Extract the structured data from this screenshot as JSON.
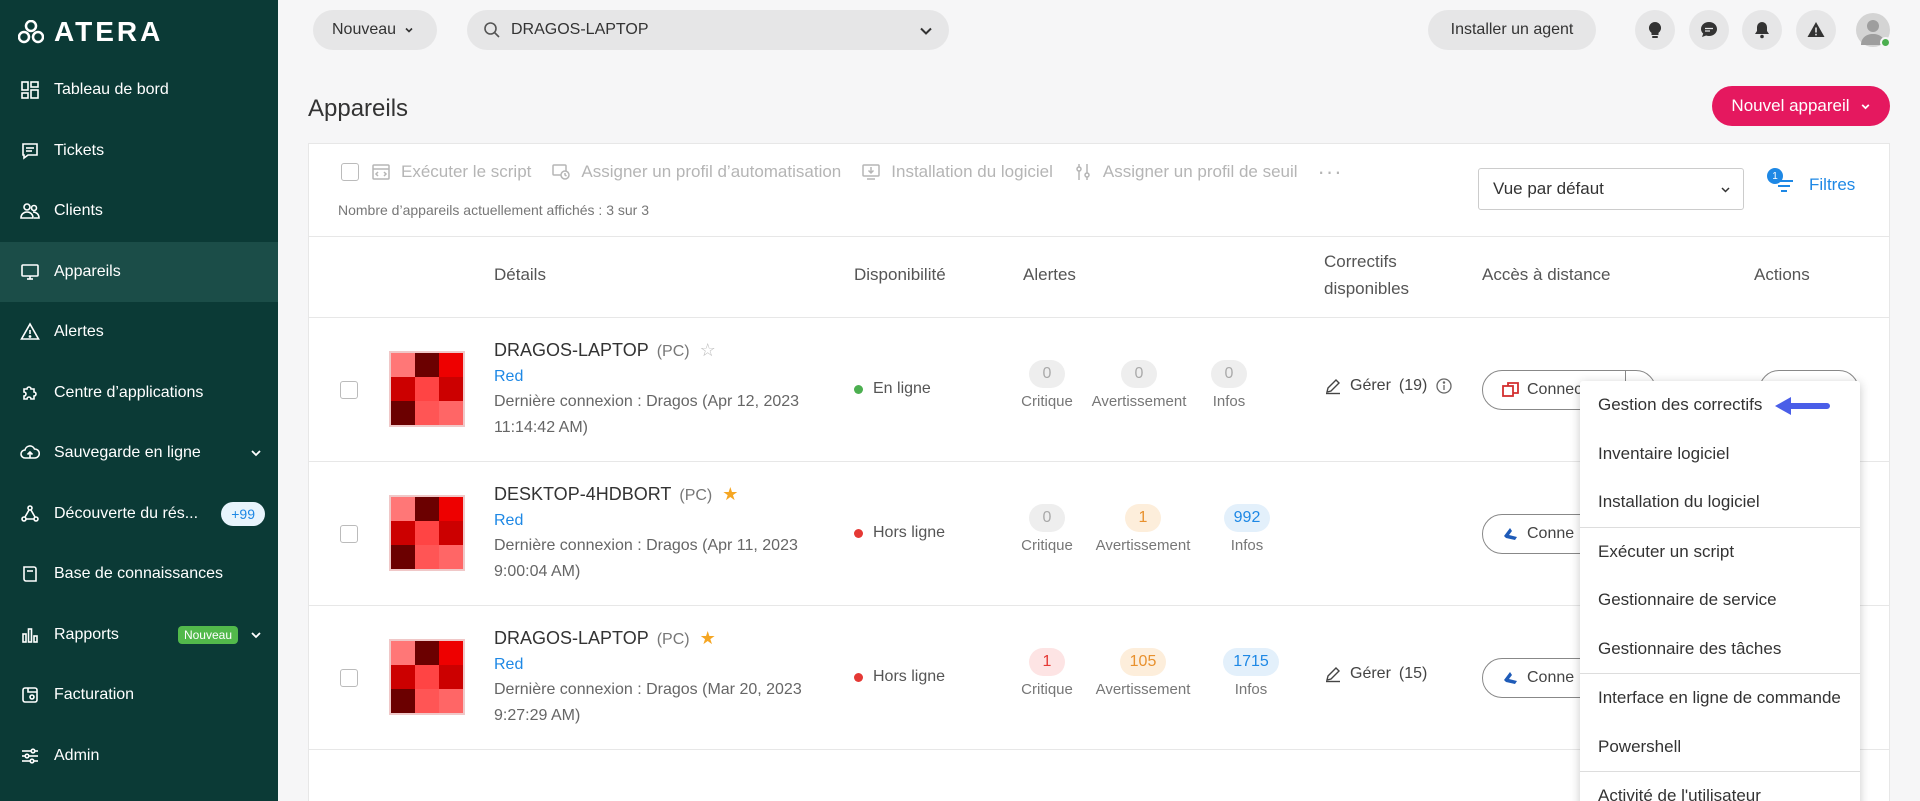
{
  "brand": {
    "logo_text": "ATERA"
  },
  "sidebar": {
    "items": [
      {
        "label": "Tableau de bord",
        "icon": "dashboard-icon"
      },
      {
        "label": "Tickets",
        "icon": "ticket-icon"
      },
      {
        "label": "Clients",
        "icon": "users-icon"
      },
      {
        "label": "Appareils",
        "icon": "monitor-icon",
        "active": true
      },
      {
        "label": "Alertes",
        "icon": "alert-triangle-icon"
      },
      {
        "label": "Centre d’applications",
        "icon": "puzzle-icon"
      },
      {
        "label": "Sauvegarde en ligne",
        "icon": "cloud-icon"
      },
      {
        "label": "Découverte du rés...",
        "icon": "network-icon",
        "badge": "+99"
      },
      {
        "label": "Base de connaissances",
        "icon": "book-icon"
      },
      {
        "label": "Rapports",
        "icon": "bar-chart-icon",
        "badge": "Nouveau"
      },
      {
        "label": "Facturation",
        "icon": "billing-icon"
      },
      {
        "label": "Admin",
        "icon": "sliders-icon"
      }
    ]
  },
  "topbar": {
    "new_label": "Nouveau",
    "search_value": "DRAGOS-LAPTOP",
    "install_agent_label": "Installer un agent"
  },
  "page": {
    "title": "Appareils",
    "new_device_label": "Nouvel appareil"
  },
  "toolbar": {
    "run_script": "Exécuter le script",
    "assign_automation": "Assigner un profil d’automatisation",
    "software_install": "Installation du logiciel",
    "assign_threshold": "Assigner un profil de seuil",
    "more": "···",
    "count_text": "Nombre d’appareils actuellement affichés : 3 sur 3",
    "view_value": "Vue par défaut",
    "filters_label": "Filtres",
    "filters_count": "1"
  },
  "columns": {
    "details": "Détails",
    "availability": "Disponibilité",
    "alerts": "Alertes",
    "patches_line1": "Correctifs",
    "patches_line2": "disponibles",
    "remote": "Accès à distance",
    "actions": "Actions"
  },
  "alert_labels": {
    "critical": "Critique",
    "warning": "Avertissement",
    "info": "Infos"
  },
  "rows": [
    {
      "name": "DRAGOS-LAPTOP",
      "type": "(PC)",
      "starred": false,
      "client": "Red",
      "last_line1": "Dernière connexion : Dragos (Apr 12, 2023",
      "last_line2": "11:14:42 AM)",
      "status": "En ligne",
      "status_color": "#4caf50",
      "critical": "0",
      "warning": "0",
      "info": "0",
      "manage": "Gérer",
      "manage_count": "(19)",
      "connect": "Connect"
    },
    {
      "name": "DESKTOP-4HDBORT",
      "type": "(PC)",
      "starred": true,
      "client": "Red",
      "last_line1": "Dernière connexion : Dragos (Apr 11, 2023",
      "last_line2": "9:00:04 AM)",
      "status": "Hors ligne",
      "status_color": "#e53935",
      "critical": "0",
      "warning": "1",
      "info": "992",
      "manage": "",
      "manage_count": "",
      "connect": "Conne"
    },
    {
      "name": "DRAGOS-LAPTOP",
      "type": "(PC)",
      "starred": true,
      "client": "Red",
      "last_line1": "Dernière connexion : Dragos (Mar 20, 2023",
      "last_line2": "9:27:29 AM)",
      "status": "Hors ligne",
      "status_color": "#e53935",
      "critical": "1",
      "warning": "105",
      "info": "1715",
      "manage": "Gérer",
      "manage_count": "(15)",
      "connect": "Conne"
    }
  ],
  "menu": {
    "items": [
      "Gestion des correctifs",
      "Inventaire logiciel",
      "Installation du logiciel",
      "Exécuter un script",
      "Gestionnaire de service",
      "Gestionnaire des tâches",
      "Interface en ligne de commande",
      "Powershell",
      "Activité de l'utilisateur"
    ]
  },
  "colors": {
    "sidebar_bg": "#0b3a36",
    "accent_pink": "#e5185f",
    "link_blue": "#1e88e5",
    "online_green": "#4caf50",
    "offline_red": "#e53935"
  }
}
